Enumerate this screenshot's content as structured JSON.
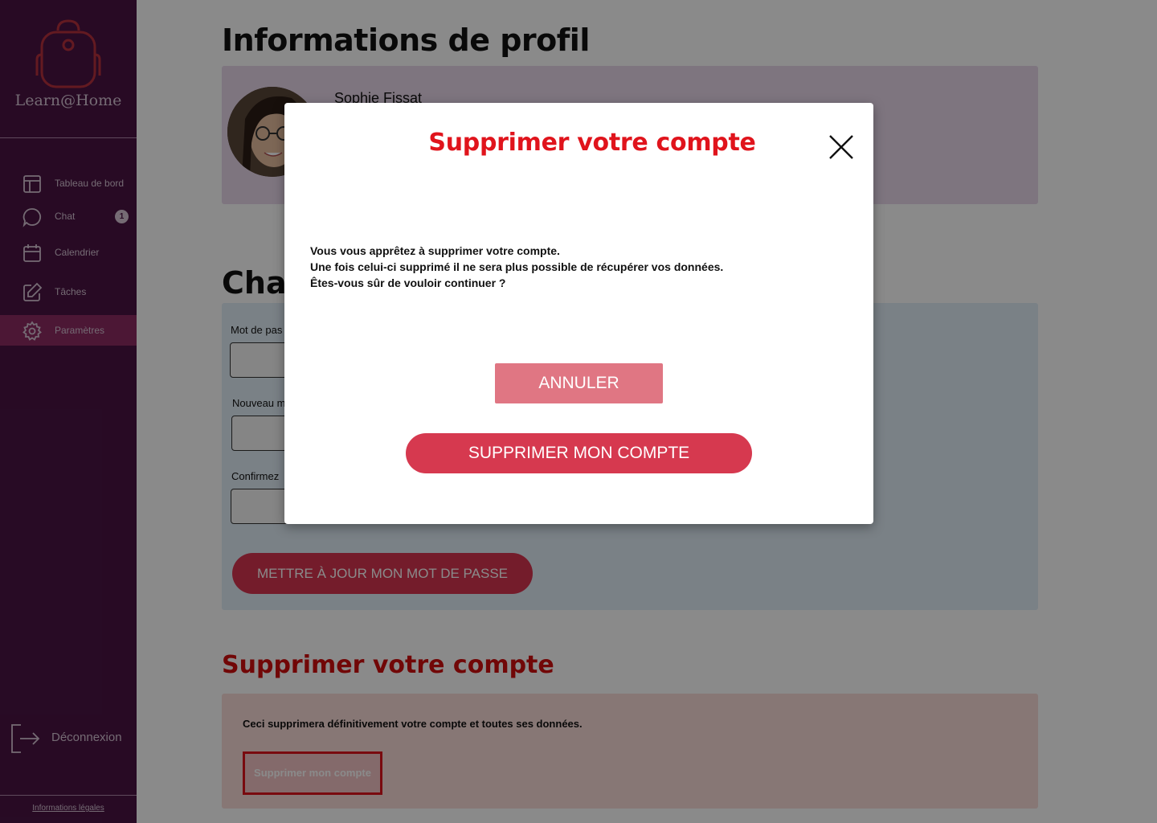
{
  "app": {
    "name": "Learn@Home"
  },
  "sidebar": {
    "items": [
      {
        "label": "Tableau de bord",
        "icon": "layout-icon"
      },
      {
        "label": "Chat",
        "icon": "chat-icon",
        "badge": "1"
      },
      {
        "label": "Calendrier",
        "icon": "calendar-icon"
      },
      {
        "label": "Tâches",
        "icon": "edit-icon"
      },
      {
        "label": "Paramètres",
        "icon": "gear-icon",
        "active": true
      }
    ],
    "logout": "Déconnexion",
    "legal": "Informations légales"
  },
  "profile": {
    "title": "Informations de profil",
    "name": "Sophie Fissat"
  },
  "password": {
    "title": "Char",
    "current_label": "Mot de pas",
    "new_label": "Nouveau m",
    "confirm_label": "Confirmez",
    "update_button": "METTRE À JOUR MON MOT DE PASSE"
  },
  "delete_section": {
    "title": "Supprimer votre compte",
    "description": "Ceci supprimera définitivement votre compte et toutes ses données.",
    "button": "Supprimer mon compte"
  },
  "modal": {
    "title": "Supprimer votre compte",
    "line1": "Vous vous apprêtez à supprimer votre compte.",
    "line2": "Une fois celui-ci supprimé il ne sera plus possible de récupérer vos données.",
    "line3": "Êtes-vous sûr de vouloir continuer ?",
    "cancel": "ANNULER",
    "confirm": "SUPPRIMER MON COMPTE"
  },
  "colors": {
    "sidebar_bg": "#4a1444",
    "active_item": "#8c2b63",
    "danger": "#e0141c",
    "button_pink": "#d6394f"
  }
}
